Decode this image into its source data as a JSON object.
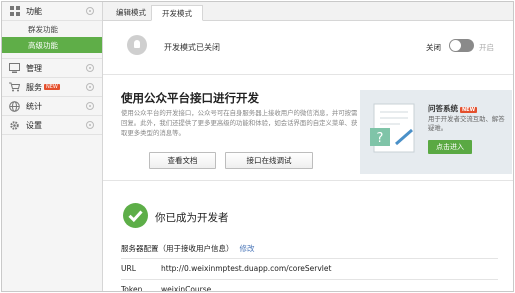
{
  "sidebar": {
    "items": [
      {
        "label": "功能",
        "icon": "grid-icon"
      },
      {
        "label": "管理",
        "icon": "monitor-icon"
      },
      {
        "label": "服务",
        "icon": "cart-icon",
        "badge": "NEW"
      },
      {
        "label": "统计",
        "icon": "globe-icon"
      },
      {
        "label": "设置",
        "icon": "gear-icon"
      }
    ],
    "subitems": [
      {
        "label": "群发功能"
      },
      {
        "label": "高级功能"
      }
    ]
  },
  "tabs": [
    {
      "label": "编辑模式"
    },
    {
      "label": "开发模式"
    }
  ],
  "status": {
    "text": "开发模式已关闭",
    "off_label": "关闭",
    "on_label": "开启"
  },
  "info": {
    "title": "使用公众平台接口进行开发",
    "desc": "使用公众平台的开发接口，公众号可在自身服务器上接收用户的微信消息，并可按需回复。此外，我们还提供了更多更高级的功能和体验，如会话界面的自定义菜单、获取更多类型的消息等。",
    "btn_docs": "查看文档",
    "btn_debug": "接口在线调试"
  },
  "promo": {
    "title": "问答系统",
    "badge": "NEW",
    "desc": "用于开发者交流互助、解答疑难。",
    "button": "点击进入"
  },
  "developer": {
    "title": "你已成为开发者",
    "config_label": "服务器配置（用于接收用户信息）",
    "edit": "修改",
    "rows": [
      {
        "key": "URL",
        "value": "http://0.weixinmptest.duapp.com/coreServlet"
      },
      {
        "key": "Token",
        "value": "weixinCourse"
      }
    ]
  },
  "colors": {
    "accent": "#5fae48",
    "link": "#4a76b8",
    "badge": "#e4502d"
  }
}
